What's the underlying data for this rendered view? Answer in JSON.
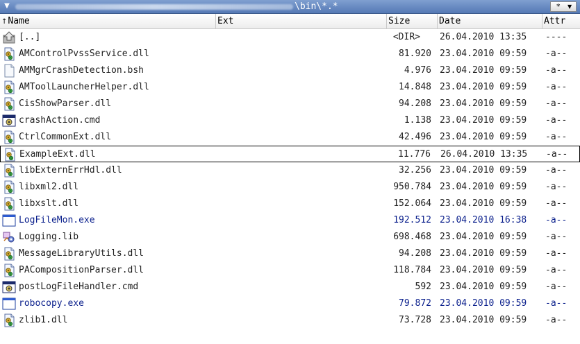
{
  "titlebar": {
    "path": "\\bin\\*.*",
    "filter_label": "*",
    "dropdown_arrow": "▼",
    "colors": {
      "bg_top": "#7f9fd0",
      "bg_bottom": "#5579b5"
    }
  },
  "columns": {
    "name": "Name",
    "ext": "Ext",
    "size": "Size",
    "date": "Date",
    "attr": "Attr",
    "sort_arrow": "↑"
  },
  "rows": [
    {
      "icon": "up-folder-icon",
      "name": "[..]",
      "size": "<DIR>",
      "date": "26.04.2010 13:35",
      "attr": "----"
    },
    {
      "icon": "dll-icon",
      "name": "AMControlPvssService.dll",
      "size": "81.920",
      "date": "23.04.2010 09:59",
      "attr": "-a--"
    },
    {
      "icon": "file-icon",
      "name": "AMMgrCrashDetection.bsh",
      "size": "4.976",
      "date": "23.04.2010 09:59",
      "attr": "-a--"
    },
    {
      "icon": "dll-icon",
      "name": "AMToolLauncherHelper.dll",
      "size": "14.848",
      "date": "23.04.2010 09:59",
      "attr": "-a--"
    },
    {
      "icon": "dll-icon",
      "name": "CisShowParser.dll",
      "size": "94.208",
      "date": "23.04.2010 09:59",
      "attr": "-a--"
    },
    {
      "icon": "cmd-icon",
      "name": "crashAction.cmd",
      "size": "1.138",
      "date": "23.04.2010 09:59",
      "attr": "-a--"
    },
    {
      "icon": "dll-icon",
      "name": "CtrlCommonExt.dll",
      "size": "42.496",
      "date": "23.04.2010 09:59",
      "attr": "-a--"
    },
    {
      "icon": "dll-icon",
      "name": "ExampleExt.dll",
      "size": "11.776",
      "date": "26.04.2010 13:35",
      "attr": "-a--"
    },
    {
      "icon": "dll-icon",
      "name": "libExternErrHdl.dll",
      "size": "32.256",
      "date": "23.04.2010 09:59",
      "attr": "-a--"
    },
    {
      "icon": "dll-icon",
      "name": "libxml2.dll",
      "size": "950.784",
      "date": "23.04.2010 09:59",
      "attr": "-a--"
    },
    {
      "icon": "dll-icon",
      "name": "libxslt.dll",
      "size": "152.064",
      "date": "23.04.2010 09:59",
      "attr": "-a--"
    },
    {
      "icon": "exe-icon",
      "name": "LogFileMon.exe",
      "size": "192.512",
      "date": "23.04.2010 16:38",
      "attr": "-a--"
    },
    {
      "icon": "lib-icon",
      "name": "Logging.lib",
      "size": "698.468",
      "date": "23.04.2010 09:59",
      "attr": "-a--"
    },
    {
      "icon": "dll-icon",
      "name": "MessageLibraryUtils.dll",
      "size": "94.208",
      "date": "23.04.2010 09:59",
      "attr": "-a--"
    },
    {
      "icon": "dll-icon",
      "name": "PACompositionParser.dll",
      "size": "118.784",
      "date": "23.04.2010 09:59",
      "attr": "-a--"
    },
    {
      "icon": "cmd-icon",
      "name": "postLogFileHandler.cmd",
      "size": "592",
      "date": "23.04.2010 09:59",
      "attr": "-a--"
    },
    {
      "icon": "exe-icon",
      "name": "robocopy.exe",
      "size": "79.872",
      "date": "23.04.2010 09:59",
      "attr": "-a--"
    },
    {
      "icon": "dll-icon",
      "name": "zlib1.dll",
      "size": "73.728",
      "date": "23.04.2010 09:59",
      "attr": "-a--"
    }
  ],
  "colors": {
    "text": "#1f1f1f",
    "exe_text": "#0a1f8c",
    "focus_border": "#000000"
  }
}
